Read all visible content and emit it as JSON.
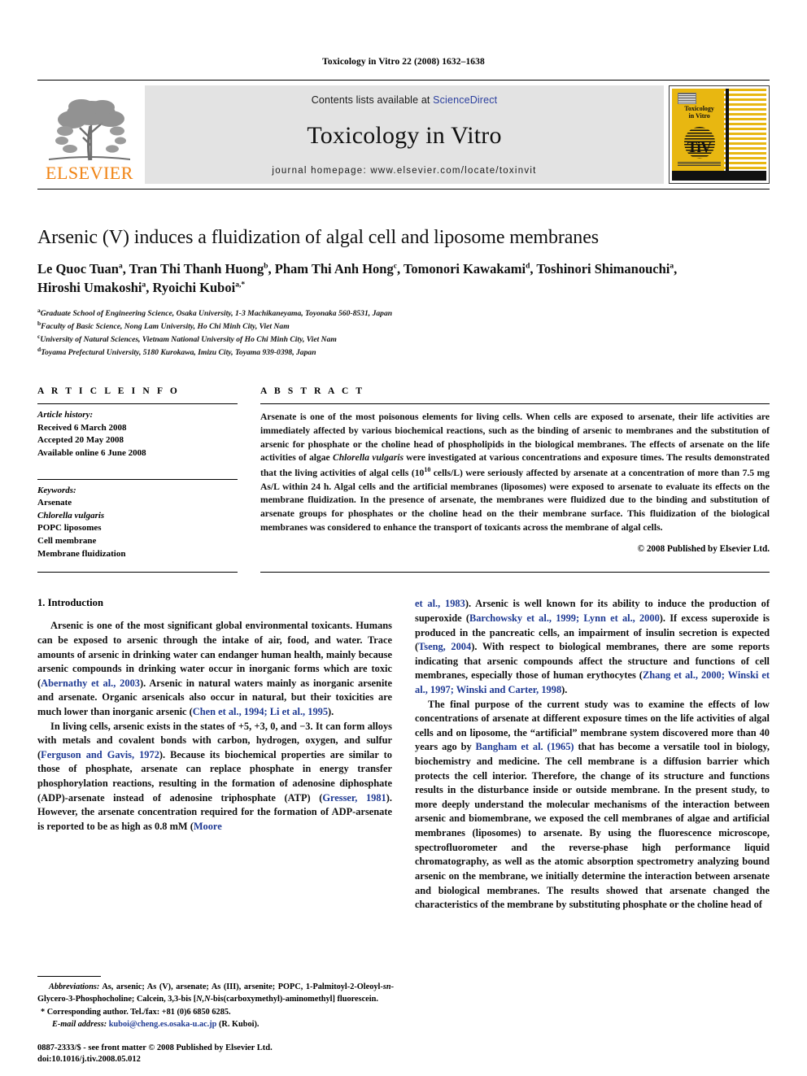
{
  "running_head": "Toxicology in Vitro 22 (2008) 1632–1638",
  "masthead": {
    "publisher_wordmark": "ELSEVIER",
    "contents_prefix": "Contents lists available at ",
    "contents_link": "ScienceDirect",
    "journal_name": "Toxicology in Vitro",
    "homepage": "journal homepage: www.elsevier.com/locate/toxinvit",
    "cover_title_line1": "Toxicology",
    "cover_title_line2": "in Vitro",
    "cover_logo_text": "TiV",
    "colors": {
      "band_bg": "#e3e3e3",
      "link": "#2b3f9e",
      "elsevier_orange": "#F08313",
      "cover_gold": "#E8B711"
    }
  },
  "article": {
    "title": "Arsenic (V) induces a fluidization of algal cell and liposome membranes",
    "authors_html": "Le Quoc Tuan<sup>a</sup>, Tran Thi Thanh Huong<sup>b</sup>, Pham Thi Anh Hong<sup>c</sup>, Tomonori Kawakami<sup>d</sup>, Toshinori Shimanouchi<sup>a</sup>, Hiroshi Umakoshi<sup>a</sup>, Ryoichi Kuboi<sup>a,*</sup>",
    "affiliations": [
      {
        "marker": "a",
        "text": "Graduate School of Engineering Science, Osaka University, 1-3 Machikaneyama, Toyonaka 560-8531, Japan"
      },
      {
        "marker": "b",
        "text": "Faculty of Basic Science, Nong Lam University, Ho Chi Minh City, Viet Nam"
      },
      {
        "marker": "c",
        "text": "University of Natural Sciences, Vietnam National University of Ho Chi Minh City, Viet Nam"
      },
      {
        "marker": "d",
        "text": "Toyama Prefectural University, 5180 Kurokawa, Imizu City, Toyama 939-0398, Japan"
      }
    ]
  },
  "article_info": {
    "heading": "A R T I C L E   I N F O",
    "history_label": "Article history:",
    "history": [
      "Received 6 March 2008",
      "Accepted 20 May 2008",
      "Available online 6 June 2008"
    ],
    "keywords_label": "Keywords:",
    "keywords": [
      {
        "text": "Arsenate",
        "italic": false
      },
      {
        "text": "Chlorella vulgaris",
        "italic": true
      },
      {
        "text": "POPC liposomes",
        "italic": false
      },
      {
        "text": "Cell membrane",
        "italic": false
      },
      {
        "text": "Membrane fluidization",
        "italic": false
      }
    ]
  },
  "abstract": {
    "heading": "A B S T R A C T",
    "body_html": "Arsenate is one of the most poisonous elements for living cells. When cells are exposed to arsenate, their life activities are immediately affected by various biochemical reactions, such as the binding of arsenic to membranes and the substitution of arsenic for phosphate or the choline head of phospholipids in the biological membranes. The effects of arsenate on the life activities of algae <i>Chlorella vulgaris</i> were investigated at various concentrations and exposure times. The results demonstrated that the living activities of algal cells (10<sup>10</sup> cells/L) were seriously affected by arsenate at a concentration of more than 7.5 mg As/L within 24 h. Algal cells and the artificial membranes (liposomes) were exposed to arsenate to evaluate its effects on the membrane fluidization. In the presence of arsenate, the membranes were fluidized due to the binding and substitution of arsenate groups for phosphates or the choline head on the their membrane surface. This fluidization of the biological membranes was considered to enhance the transport of toxicants across the membrane of algal cells.",
    "copyright": "© 2008 Published by Elsevier Ltd."
  },
  "intro": {
    "heading": "1. Introduction",
    "left_paragraphs_html": [
      "Arsenic is one of the most significant global environmental toxicants. Humans can be exposed to arsenic through the intake of air, food, and water. Trace amounts of arsenic in drinking water can endanger human health, mainly because arsenic compounds in drinking water occur in inorganic forms which are toxic (<span class=\"cite\">Abernathy et al., 2003</span>). Arsenic in natural waters mainly as inorganic arsenite and arsenate. Organic arsenicals also occur in natural, but their toxicities are much lower than inorganic arsenic (<span class=\"cite\">Chen et al., 1994; Li et al., 1995</span>).",
      "In living cells, arsenic exists in the states of +5, +3, 0, and −3. It can form alloys with metals and covalent bonds with carbon, hydrogen, oxygen, and sulfur (<span class=\"cite\">Ferguson and Gavis, 1972</span>). Because its biochemical properties are similar to those of phosphate, arsenate can replace phosphate in energy transfer phosphorylation reactions, resulting in the formation of adenosine diphosphate (ADP)-arsenate instead of adenosine triphosphate (ATP) (<span class=\"cite\">Gresser, 1981</span>). However, the arsenate concentration required for the formation of ADP-arsenate is reported to be as high as 0.8 mM (<span class=\"cite\">Moore</span>"
    ],
    "right_paragraphs_html": [
      "<span class=\"cite\">et al., 1983</span>). Arsenic is well known for its ability to induce the production of superoxide (<span class=\"cite\">Barchowsky et al., 1999; Lynn et al., 2000</span>). If excess superoxide is produced in the pancreatic cells, an impairment of insulin secretion is expected (<span class=\"cite\">Tseng, 2004</span>). With respect to biological membranes, there are some reports indicating that arsenic compounds affect the structure and functions of cell membranes, especially those of human erythocytes (<span class=\"cite\">Zhang et al., 2000; Winski et al., 1997; Winski and Carter, 1998</span>).",
      "The final purpose of the current study was to examine the effects of low concentrations of arsenate at different exposure times on the life activities of algal cells and on liposome, the “artificial” membrane system discovered more than 40 years ago by <span class=\"cite\">Bangham et al. (1965)</span> that has become a versatile tool in biology, biochemistry and medicine. The cell membrane is a diffusion barrier which protects the cell interior. Therefore, the change of its structure and functions results in the disturbance inside or outside membrane. In the present study, to more deeply understand the molecular mechanisms of the interaction between arsenic and biomembrane, we exposed the cell membranes of algae and artificial membranes (liposomes) to arsenate. By using the fluorescence microscope, spectrofluorometer and the reverse-phase high performance liquid chromatography, as well as the atomic absorption spectrometry analyzing bound arsenic on the membrane, we initially determine the interaction between arsenate and biological membranes. The results showed that arsenate changed the characteristics of the membrane by substituting phosphate or the choline head of"
    ]
  },
  "footnotes": {
    "abbreviations_html": "<i>Abbreviations:</i> As, arsenic; As (V), arsenate; As (III), arsenite; POPC, 1-Palmitoyl-2-Oleoyl-<i>sn</i>-Glycero-3-Phosphocholine; Calcein, 3,3-bis [<i>N,N</i>-bis(carboxymethyl)-aminomethyl] fluorescein.",
    "corresponding_html": "* Corresponding author. Tel./fax: +81 (0)6 6850 6285.",
    "email_label": "E-mail address:",
    "email": "kuboi@cheng.es.osaka-u.ac.jp",
    "email_suffix": "(R. Kuboi).",
    "issn_line": "0887-2333/$ - see front matter © 2008 Published by Elsevier Ltd.",
    "doi_line": "doi:10.1016/j.tiv.2008.05.012"
  }
}
